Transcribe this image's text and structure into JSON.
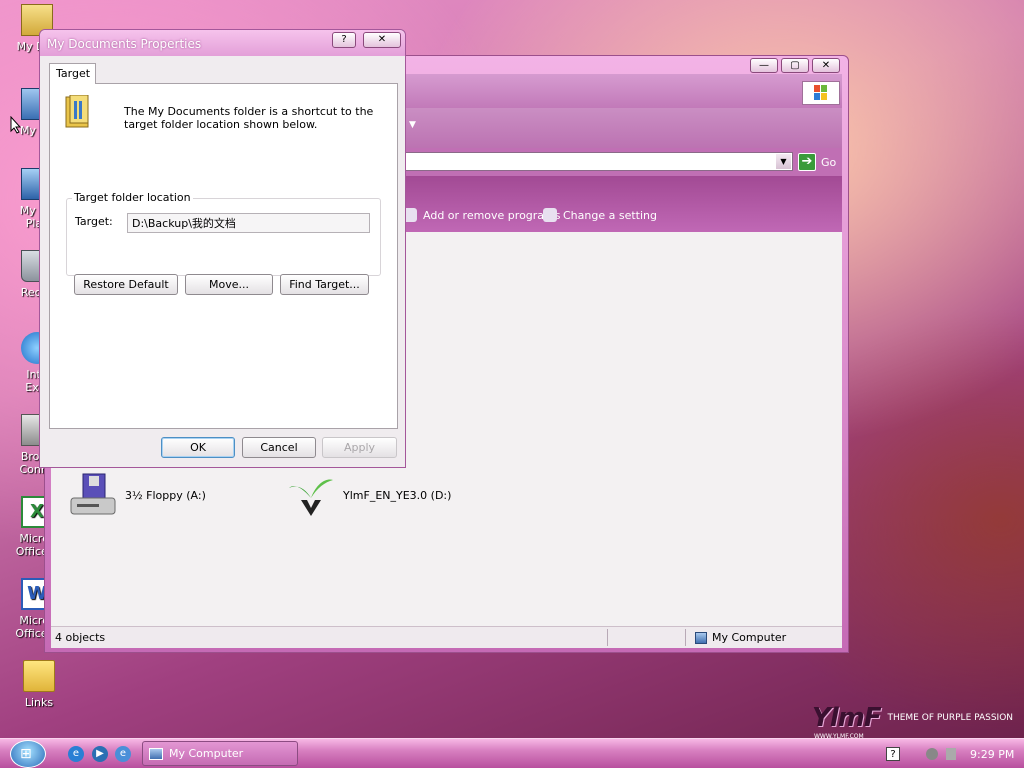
{
  "desktop": {
    "icons": [
      {
        "label": "My Doc"
      },
      {
        "label": "My Co"
      },
      {
        "label": "My Ne\nPlac"
      },
      {
        "label": "Recyc"
      },
      {
        "label": "Inte\nExpl"
      },
      {
        "label": "Broad\nConne"
      },
      {
        "label": "Micros\nOffice E"
      },
      {
        "label": "Micros\nOffice V"
      },
      {
        "label": "Links"
      }
    ],
    "watermark": {
      "logo": "YlmF",
      "tagline": "THEME OF PURPLE PASSION",
      "url": "WWW.YLMF.COM"
    }
  },
  "explorer": {
    "caption_buttons": [
      "—",
      "▢",
      "✕"
    ],
    "address": {
      "go_label": "Go"
    },
    "tasks": [
      {
        "label": "Add or remove programs"
      },
      {
        "label": "Change a setting"
      }
    ],
    "drives": [
      {
        "label": "3½ Floppy (A:)"
      },
      {
        "label": "YlmF_EN_YE3.0 (D:)"
      }
    ],
    "status": {
      "left": "4 objects",
      "right": "My Computer"
    }
  },
  "dialog": {
    "title": "My Documents Properties",
    "help_glyph": "?",
    "close_glyph": "✕",
    "tab": "Target",
    "description": "The My Documents folder is a shortcut to the target folder location shown below.",
    "group_label": "Target folder location",
    "target_label": "Target:",
    "target_value": "D:\\Backup\\我的文档",
    "buttons": {
      "restore": "Restore Default",
      "move": "Move...",
      "find": "Find Target...",
      "ok": "OK",
      "cancel": "Cancel",
      "apply": "Apply"
    }
  },
  "taskbar": {
    "task_button": "My Computer",
    "tray_help": "?",
    "clock": "9:29 PM"
  }
}
